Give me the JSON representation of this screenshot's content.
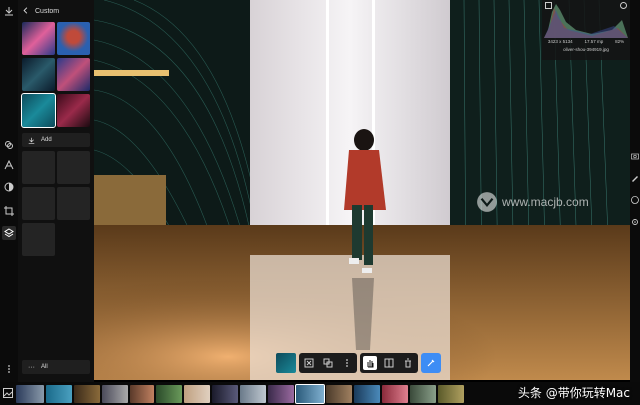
{
  "panel": {
    "title": "Custom",
    "add_label": "Add",
    "all_label": "All"
  },
  "histogram": {
    "dimensions": "3423 x 5134",
    "megapixels": "17.57 mp",
    "zoom": "82%",
    "filename": "oliver-shou-394919.jpg"
  },
  "watermark": {
    "text": "www.macjb.com"
  },
  "corner_caption": "头条 @带你玩转Mac",
  "colors": {
    "accent": "#3d8df5",
    "panel_bg": "#101010",
    "slot_bg": "#242424"
  },
  "icons": {
    "rail": [
      "layers-icon",
      "text-icon",
      "mask-icon",
      "crop-icon",
      "stack-icon",
      "more-icon"
    ],
    "toolbar": [
      "fit-icon",
      "compare-icon",
      "more-icon",
      "hand-icon",
      "split-icon",
      "trash-icon",
      "eyedropper-icon"
    ]
  }
}
